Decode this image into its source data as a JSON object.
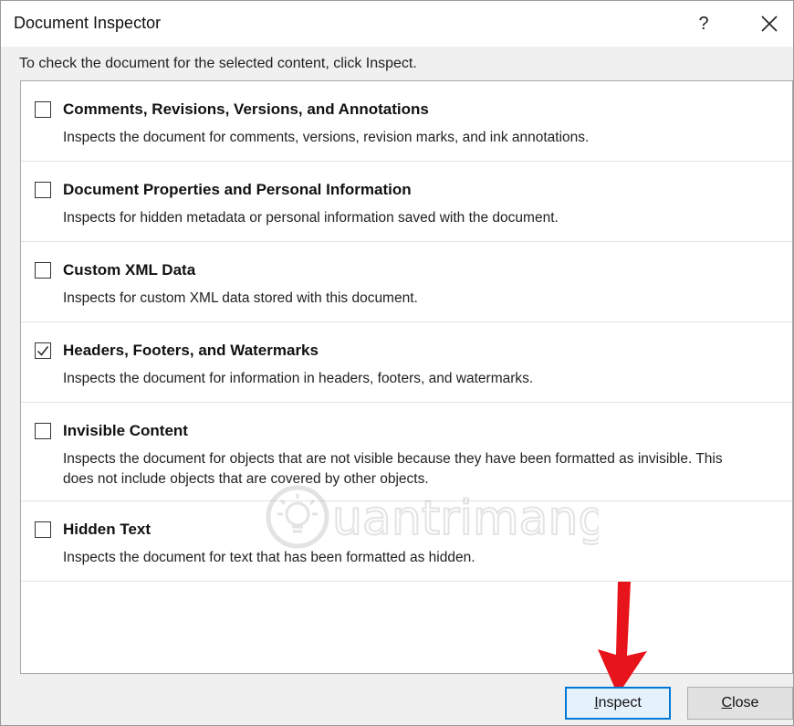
{
  "dialog": {
    "title": "Document Inspector",
    "help_label": "?",
    "instruction": "To check the document for the selected content, click Inspect."
  },
  "items": [
    {
      "title": "Comments, Revisions, Versions, and Annotations",
      "description": "Inspects the document for comments, versions, revision marks, and ink annotations.",
      "checked": false
    },
    {
      "title": "Document Properties and Personal Information",
      "description": "Inspects for hidden metadata or personal information saved with the document.",
      "checked": false
    },
    {
      "title": "Custom XML Data",
      "description": "Inspects for custom XML data stored with this document.",
      "checked": false
    },
    {
      "title": "Headers, Footers, and Watermarks",
      "description": "Inspects the document for information in headers, footers, and watermarks.",
      "checked": true
    },
    {
      "title": "Invisible Content",
      "description": "Inspects the document for objects that are not visible because they have been formatted as invisible. This does not include objects that are covered by other objects.",
      "checked": false
    },
    {
      "title": "Hidden Text",
      "description": "Inspects the document for text that has been formatted as hidden.",
      "checked": false
    }
  ],
  "buttons": {
    "inspect": {
      "access_key": "I",
      "rest": "nspect"
    },
    "close": {
      "access_key": "C",
      "rest": "lose"
    }
  },
  "watermark_text": "uantrimang",
  "colors": {
    "focus_border": "#0078d7",
    "annotation_arrow": "#e8141b"
  }
}
